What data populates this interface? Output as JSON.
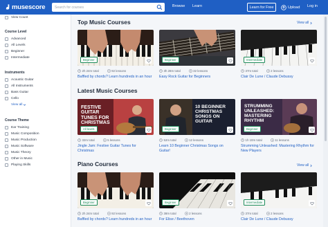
{
  "header": {
    "logo": "musescore",
    "search_placeholder": "Search for courses",
    "nav": [
      "Browse",
      "Learn"
    ],
    "learn_free": "Learn for Free",
    "upload": "Upload",
    "login": "Log in"
  },
  "sidebar": {
    "top_item": "View Count",
    "level": {
      "title": "Course Level",
      "options": [
        "Advanced",
        "All Levels",
        "Beginner",
        "Intermediate"
      ]
    },
    "instruments": {
      "title": "Instruments",
      "options": [
        "Acoustic Guitar",
        "All Instruments",
        "Bass Guitar",
        "Cello"
      ],
      "view_all": "View all"
    },
    "theme": {
      "title": "Course Theme",
      "options": [
        "Ear Training",
        "Music Composition",
        "Music Production",
        "Music Software",
        "Music Theory",
        "Other in Music",
        "Playing Skills"
      ]
    }
  },
  "sections": [
    {
      "title": "Top Music Courses",
      "view_all": "View all",
      "cards": [
        {
          "title": "Baffled by chords? Learn hundreds in an hour",
          "level": "Beginner",
          "duration": "2h 24m total",
          "lessons": "92 lessons"
        },
        {
          "title": "Easy Rock Guitar for Beginners",
          "level": "Beginner",
          "duration": "3h 28m total",
          "lessons": "32 lessons"
        },
        {
          "title": "Clair De Lune / Claude Debussy",
          "level": "Intermediate",
          "duration": "37m total",
          "lessons": "2 lessons"
        }
      ]
    },
    {
      "title": "Latest Music Courses",
      "view_all": "View all",
      "cards": [
        {
          "title": "Jingle Jam: Festive Guitar Tunes for Christmas",
          "level": "All levels",
          "duration": "32m total",
          "lessons": "5 lessons",
          "overlay": "FESTIVE GUITAR TUNES FOR CHRISTMAS"
        },
        {
          "title": "Learn 10 Beginner Christmas Songs on Guitar!",
          "level": "Beginner",
          "duration": "52m total",
          "lessons": "12 lessons",
          "overlay": "10 BEGINNER CHRISTMAS SONGS ON GUITAR"
        },
        {
          "title": "Strumming Unleashed: Mastering Rhythm for New Players",
          "level": "Beginner",
          "duration": "1h 10m total",
          "lessons": "11 lessons",
          "overlay": "STRUMMING UNLEASHED: MASTERING RHYTHM"
        }
      ]
    },
    {
      "title": "Piano Courses",
      "view_all": "View all",
      "cards": [
        {
          "title": "Baffled by chords? Learn hundreds in an hour",
          "level": "Beginner",
          "duration": "2h 24m total",
          "lessons": "92 lessons"
        },
        {
          "title": "For Elise / Beethoven",
          "level": "Beginner",
          "duration": "38m total",
          "lessons": "2 lessons"
        },
        {
          "title": "Clair De Lune / Claude Debussy",
          "level": "Intermediate",
          "duration": "37m total",
          "lessons": "2 lessons"
        }
      ]
    }
  ],
  "colors": {
    "brand": "#1f5fc4",
    "level_badge": "#1a8a58",
    "link": "#1f5fc4"
  }
}
